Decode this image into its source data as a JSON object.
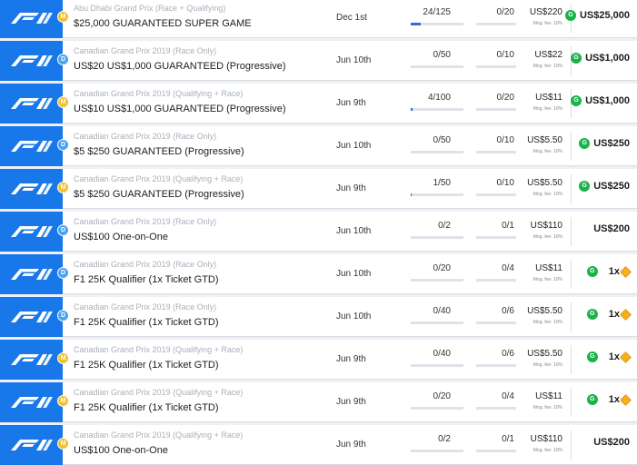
{
  "contests": [
    {
      "sport": "F1",
      "badge": "M",
      "badge_color": "gold",
      "event": "Abu Dhabi Grand Prix (Race + Qualifying)",
      "title": "$25,000 GUARANTEED SUPER GAME",
      "date": "Dec 1st",
      "entries": "24/125",
      "entries_fraction": 0.192,
      "multi": "0/20",
      "fee": "US$220",
      "fee_label": "Mng. fee: 10%",
      "prize_icon": true,
      "prize": "US$25,000",
      "ticket": false
    },
    {
      "sport": "F1",
      "badge": "D",
      "badge_color": "blue",
      "event": "Canadian Grand Prix 2019 (Race Only)",
      "title": "US$20 US$1,000 GUARANTEED (Progressive)",
      "date": "Jun 10th",
      "entries": "0/50",
      "entries_fraction": 0,
      "multi": "0/10",
      "fee": "US$22",
      "fee_label": "Mng. fee: 10%",
      "prize_icon": true,
      "prize": "US$1,000",
      "ticket": false
    },
    {
      "sport": "F1",
      "badge": "M",
      "badge_color": "gold",
      "event": "Canadian Grand Prix 2019 (Qualifying + Race)",
      "title": "US$10 US$1,000 GUARANTEED (Progressive)",
      "date": "Jun 9th",
      "entries": "4/100",
      "entries_fraction": 0.04,
      "multi": "0/20",
      "fee": "US$11",
      "fee_label": "Mng. fee: 10%",
      "prize_icon": true,
      "prize": "US$1,000",
      "ticket": false
    },
    {
      "sport": "F1",
      "badge": "D",
      "badge_color": "blue",
      "event": "Canadian Grand Prix 2019 (Race Only)",
      "title": "$5 $250 GUARANTEED (Progressive)",
      "date": "Jun 10th",
      "entries": "0/50",
      "entries_fraction": 0,
      "multi": "0/10",
      "fee": "US$5.50",
      "fee_label": "Mng. fee: 10%",
      "prize_icon": true,
      "prize": "US$250",
      "ticket": false
    },
    {
      "sport": "F1",
      "badge": "M",
      "badge_color": "gold",
      "event": "Canadian Grand Prix 2019 (Qualifying + Race)",
      "title": "$5 $250 GUARANTEED (Progressive)",
      "date": "Jun 9th",
      "entries": "1/50",
      "entries_fraction": 0.02,
      "multi": "0/10",
      "fee": "US$5.50",
      "fee_label": "Mng. fee: 10%",
      "prize_icon": true,
      "prize": "US$250",
      "ticket": false
    },
    {
      "sport": "F1",
      "badge": "D",
      "badge_color": "blue",
      "event": "Canadian Grand Prix 2019 (Race Only)",
      "title": "US$100 One-on-One",
      "date": "Jun 10th",
      "entries": "0/2",
      "entries_fraction": 0,
      "multi": "0/1",
      "fee": "US$110",
      "fee_label": "Mng. fee: 10%",
      "prize_icon": false,
      "prize": "US$200",
      "ticket": false
    },
    {
      "sport": "F1",
      "badge": "D",
      "badge_color": "blue",
      "event": "Canadian Grand Prix 2019 (Race Only)",
      "title": "F1 25K Qualifier (1x Ticket GTD)",
      "date": "Jun 10th",
      "entries": "0/20",
      "entries_fraction": 0,
      "multi": "0/4",
      "fee": "US$11",
      "fee_label": "Mng. fee: 10%",
      "prize_icon": true,
      "prize": "1x",
      "ticket": true
    },
    {
      "sport": "F1",
      "badge": "D",
      "badge_color": "blue",
      "event": "Canadian Grand Prix 2019 (Race Only)",
      "title": "F1 25K Qualifier (1x Ticket GTD)",
      "date": "Jun 10th",
      "entries": "0/40",
      "entries_fraction": 0,
      "multi": "0/6",
      "fee": "US$5.50",
      "fee_label": "Mng. fee: 10%",
      "prize_icon": true,
      "prize": "1x",
      "ticket": true
    },
    {
      "sport": "F1",
      "badge": "M",
      "badge_color": "gold",
      "event": "Canadian Grand Prix 2019 (Qualifying + Race)",
      "title": "F1 25K Qualifier (1x Ticket GTD)",
      "date": "Jun 9th",
      "entries": "0/40",
      "entries_fraction": 0,
      "multi": "0/6",
      "fee": "US$5.50",
      "fee_label": "Mng. fee: 10%",
      "prize_icon": true,
      "prize": "1x",
      "ticket": true
    },
    {
      "sport": "F1",
      "badge": "M",
      "badge_color": "gold",
      "event": "Canadian Grand Prix 2019 (Qualifying + Race)",
      "title": "F1 25K Qualifier (1x Ticket GTD)",
      "date": "Jun 9th",
      "entries": "0/20",
      "entries_fraction": 0,
      "multi": "0/4",
      "fee": "US$11",
      "fee_label": "Mng. fee: 10%",
      "prize_icon": true,
      "prize": "1x",
      "ticket": true
    },
    {
      "sport": "F1",
      "badge": "M",
      "badge_color": "gold",
      "event": "Canadian Grand Prix 2019 (Qualifying + Race)",
      "title": "US$100 One-on-One",
      "date": "Jun 9th",
      "entries": "0/2",
      "entries_fraction": 0,
      "multi": "0/1",
      "fee": "US$110",
      "fee_label": "Mng. fee: 10%",
      "prize_icon": false,
      "prize": "US$200",
      "ticket": false
    }
  ],
  "colors": {
    "logo_bg": "#1877e9",
    "progress": "#2a6fd6",
    "prize_icon": "#1bb24b",
    "badge_gold": "#f2c12e",
    "badge_blue": "#4aa3f0"
  },
  "icons": {
    "sport_logo": "f1-logo-icon",
    "prize": "guaranteed-icon",
    "ticket": "ticket-icon"
  }
}
